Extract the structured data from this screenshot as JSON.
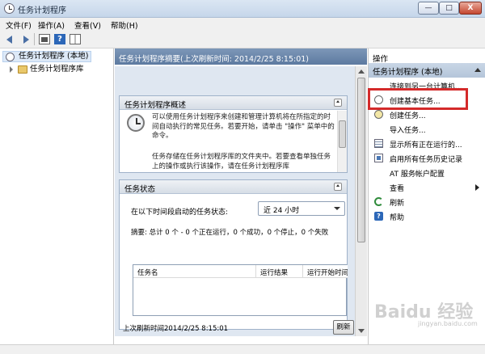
{
  "window": {
    "title": "任务计划程序",
    "buttons": {
      "minimize": "—",
      "maximize": "□",
      "close": "X"
    }
  },
  "menu": [
    "文件(F)",
    "操作(A)",
    "查看(V)",
    "帮助(H)"
  ],
  "toolbar": {
    "help_glyph": "?"
  },
  "tree": {
    "root": "任务计划程序 (本地)",
    "library": "任务计划程序库"
  },
  "center": {
    "header": "任务计划程序摘要(上次刷新时间: 2014/2/25 8:15:01)",
    "overview": {
      "title": "任务计划程序概述",
      "text1": "可以使用任务计划程序来创建和管理计算机将在所指定的时间自动执行的常见任务。若要开始，请单击 \"操作\" 菜单中的命令。",
      "text2": "任务存储在任务计划程序库的文件夹中。若要查看单独任务上的操作或执行该操作，请在任务计划程序库"
    },
    "status": {
      "title": "任务状态",
      "label": "在以下时间段启动的任务状态:",
      "dropdown_value": "近 24 小时",
      "summary": "摘要: 总计 0 个 - 0 个正在运行，0 个成功，0 个停止，0 个失败",
      "columns": [
        "任务名",
        "运行结果",
        "运行开始时间"
      ]
    },
    "last_refresh": "上次刷新时间2014/2/25 8:15:01",
    "refresh_button": "刷新"
  },
  "actions": {
    "header": "操作",
    "subheader": "任务计划程序 (本地)",
    "items": [
      {
        "label": "连接到另一台计算机...",
        "icon": "none"
      },
      {
        "label": "创建基本任务...",
        "icon": "clock-icon"
      },
      {
        "label": "创建任务...",
        "icon": "create-task-icon"
      },
      {
        "label": "导入任务...",
        "icon": "none"
      },
      {
        "label": "显示所有正在运行的...",
        "icon": "list-icon"
      },
      {
        "label": "启用所有任务历史记录",
        "icon": "log-icon"
      },
      {
        "label": "AT 服务帐户配置",
        "icon": "none"
      },
      {
        "label": "查看",
        "icon": "none"
      },
      {
        "label": "刷新",
        "icon": "refresh-icon"
      },
      {
        "label": "帮助",
        "icon": "help-icon"
      }
    ]
  },
  "watermark": {
    "text": "Baidu 经验",
    "sub": "jingyan.baidu.com"
  },
  "colors": {
    "highlight": "#d42a2a",
    "header_bg": "#6b86ab",
    "body_bg": "#dfe7f1"
  }
}
